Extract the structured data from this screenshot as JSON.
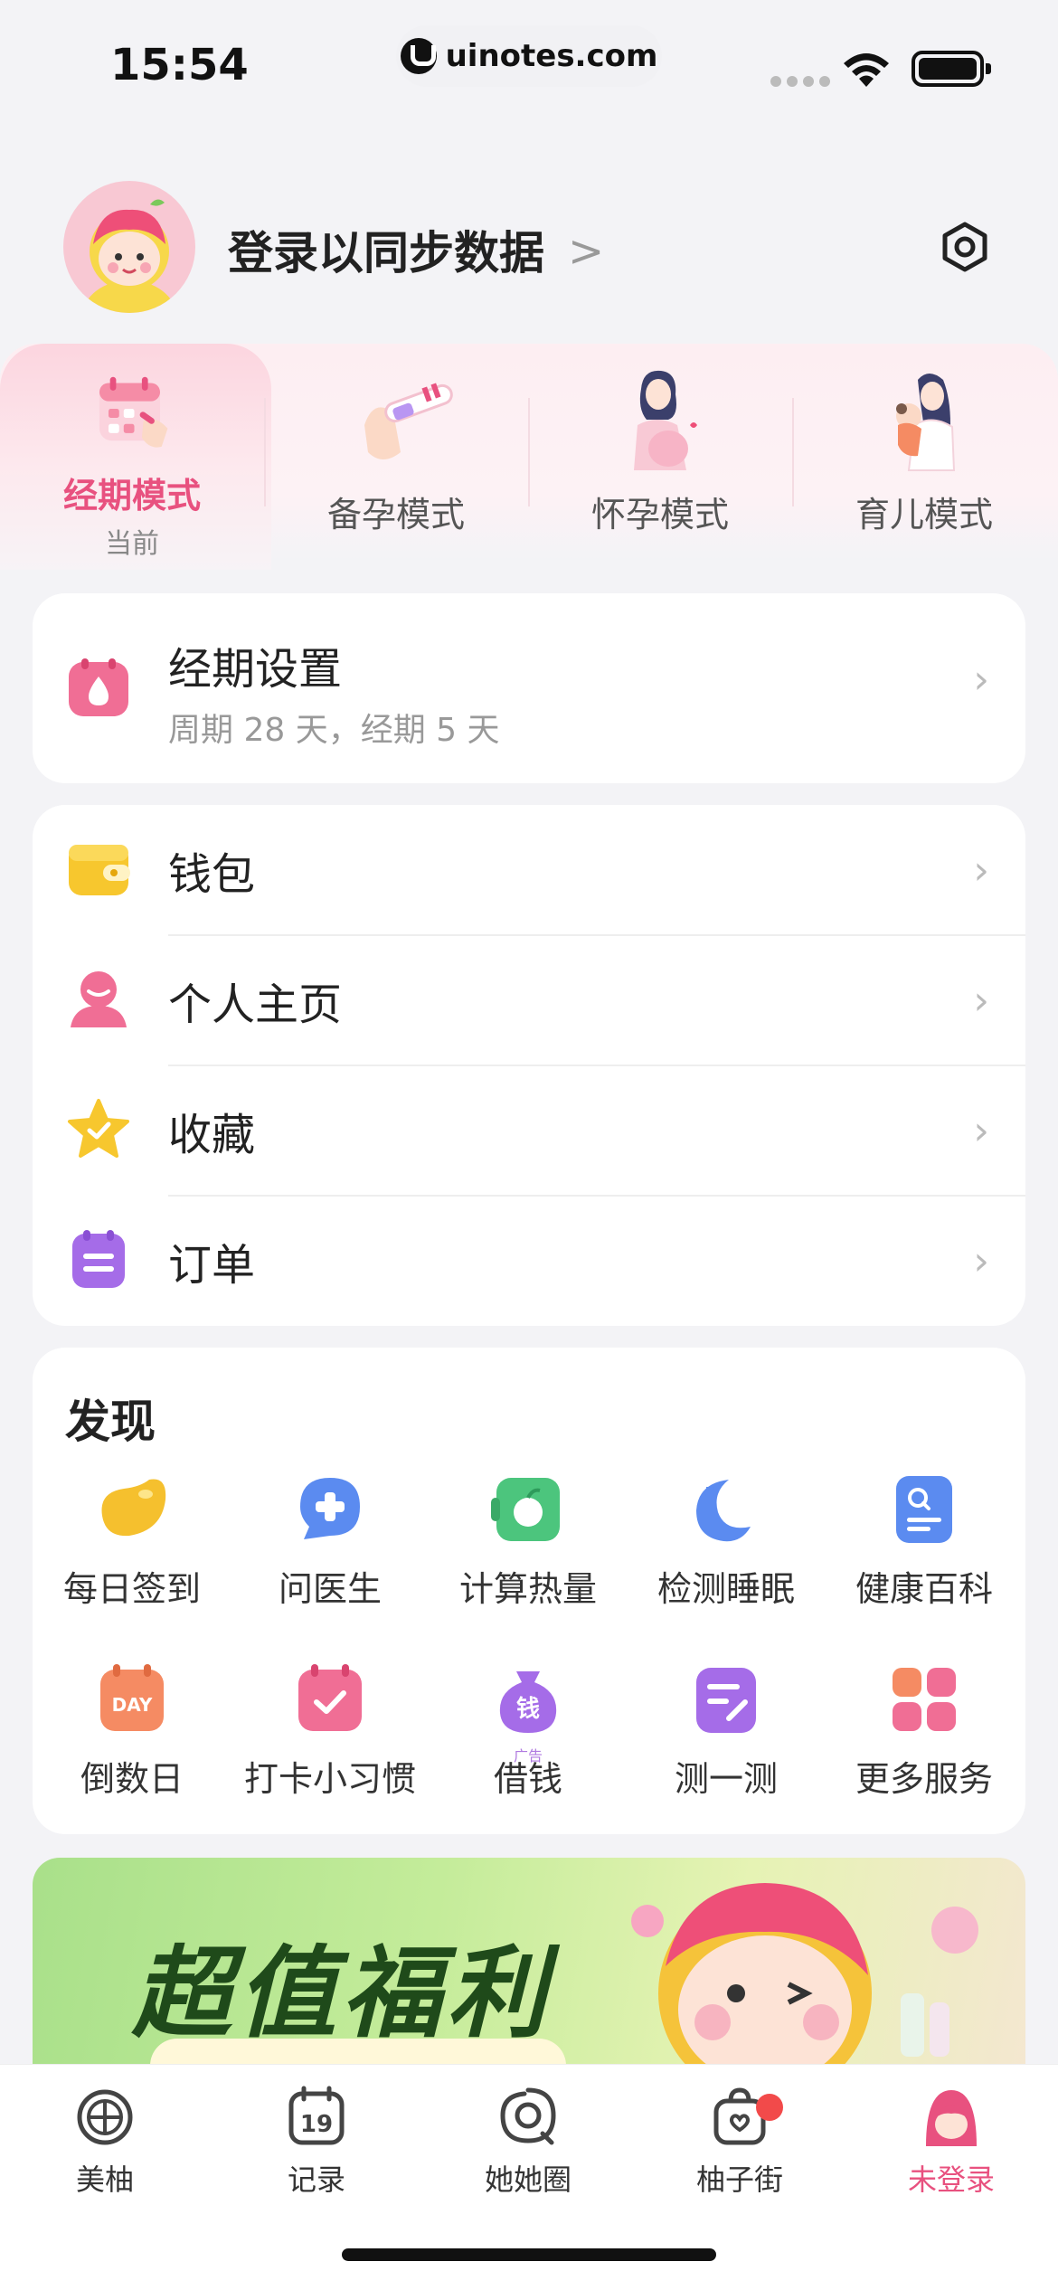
{
  "status_bar": {
    "time": "15:54",
    "url": "uinotes.com"
  },
  "profile": {
    "login_label": "登录以同步数据",
    "chevron": ">"
  },
  "modes": [
    {
      "label": "经期模式",
      "sub": "当前",
      "active": true,
      "icon": "calendar-hand-icon"
    },
    {
      "label": "备孕模式",
      "sub": "",
      "active": false,
      "icon": "test-strip-icon"
    },
    {
      "label": "怀孕模式",
      "sub": "",
      "active": false,
      "icon": "pregnant-woman-icon"
    },
    {
      "label": "育儿模式",
      "sub": "",
      "active": false,
      "icon": "mother-baby-icon"
    }
  ],
  "period_card": {
    "title": "经期设置",
    "subtitle": "周期 28 天，经期 5 天",
    "icon": "drop-calendar-icon"
  },
  "menu": [
    {
      "label": "钱包",
      "icon": "wallet-icon"
    },
    {
      "label": "个人主页",
      "icon": "person-icon"
    },
    {
      "label": "收藏",
      "icon": "star-icon"
    },
    {
      "label": "订单",
      "icon": "order-icon"
    }
  ],
  "discover": {
    "title": "发现",
    "items": [
      {
        "label": "每日签到",
        "icon": "bean-icon"
      },
      {
        "label": "问医生",
        "icon": "doctor-chat-icon"
      },
      {
        "label": "计算热量",
        "icon": "apple-calc-icon"
      },
      {
        "label": "检测睡眠",
        "icon": "moon-icon"
      },
      {
        "label": "健康百科",
        "icon": "encyclopedia-icon"
      },
      {
        "label": "倒数日",
        "icon": "day-countdown-icon",
        "icon_text": "DAY"
      },
      {
        "label": "打卡小习惯",
        "icon": "checkin-calendar-icon"
      },
      {
        "label": "借钱",
        "icon": "money-bag-icon",
        "icon_text": "钱",
        "ad": "广告"
      },
      {
        "label": "测一测",
        "icon": "quiz-icon"
      },
      {
        "label": "更多服务",
        "icon": "more-grid-icon"
      }
    ]
  },
  "banner": {
    "title": "超值福利"
  },
  "tabbar": [
    {
      "label": "美柚",
      "icon": "citrus-icon",
      "active": false
    },
    {
      "label": "记录",
      "icon": "calendar-19-icon",
      "icon_text": "19",
      "active": false
    },
    {
      "label": "她她圈",
      "icon": "spiral-chat-icon",
      "active": false
    },
    {
      "label": "柚子街",
      "icon": "shopping-bag-icon",
      "active": false,
      "badge": true
    },
    {
      "label": "未登录",
      "icon": "user-avatar-icon",
      "active": true
    }
  ],
  "colors": {
    "accent": "#e8517f",
    "background": "#f3f3f6"
  }
}
